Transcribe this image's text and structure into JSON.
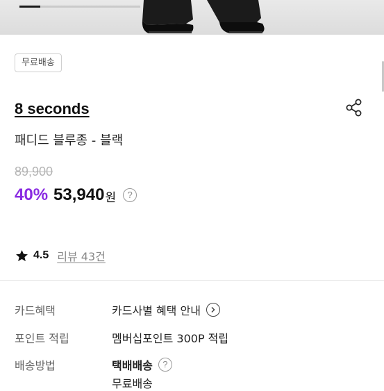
{
  "gallery": {
    "progress": 0.17
  },
  "badge": {
    "label": "무료배송"
  },
  "product": {
    "brand": "8 seconds",
    "name": "패디드 블루종 - 블랙",
    "original_price": "89,900",
    "discount": "40%",
    "sale_price": "53,940",
    "currency": "원"
  },
  "icons": {
    "share": "share-icon",
    "help": "question-circle-icon",
    "star": "star-icon",
    "arrow": "chevron-right-circle-icon"
  },
  "rating": {
    "score": "4.5",
    "reviews_label": "리뷰 43건"
  },
  "info": {
    "card": {
      "label": "카드혜택",
      "value": "카드사별 혜택 안내"
    },
    "points": {
      "label": "포인트 적립",
      "value": "멤버십포인트 300P 적립"
    },
    "shipping": {
      "label": "배송방법",
      "value": "택배배송",
      "sub_value": "무료배송"
    }
  },
  "colors": {
    "discount": "#8a2be2",
    "text": "#111111",
    "muted": "#666666"
  }
}
